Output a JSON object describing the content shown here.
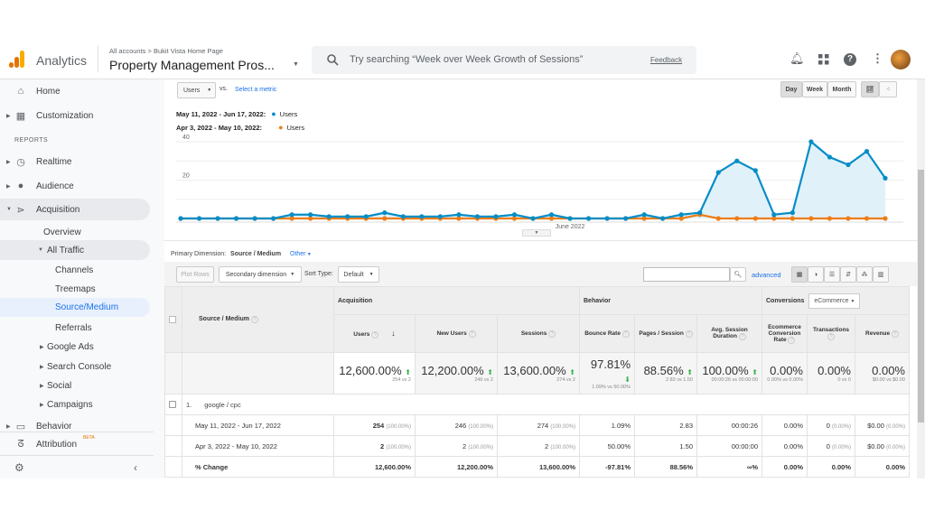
{
  "header": {
    "app_name": "Analytics",
    "breadcrumb": "All accounts > Bukit Vista Home Page",
    "property": "Property Management Pros...",
    "search_placeholder": "Try searching “Week over Week Growth of Sessions”",
    "feedback": "Feedback",
    "icons": [
      "bell-icon",
      "apps-icon",
      "help-icon",
      "more-vert-icon",
      "avatar"
    ]
  },
  "sidebar": {
    "items": [
      {
        "label": "Home",
        "icon": "home-icon"
      },
      {
        "label": "Customization",
        "icon": "dashboard-icon"
      }
    ],
    "reports_label": "REPORTS",
    "reports": [
      {
        "label": "Realtime",
        "icon": "clock-icon"
      },
      {
        "label": "Audience",
        "icon": "person-icon"
      },
      {
        "label": "Acquisition",
        "icon": "acquisition-icon"
      }
    ],
    "acq_sub": [
      "Overview",
      "All Traffic"
    ],
    "all_traffic_sub": [
      "Channels",
      "Treemaps",
      "Source/Medium",
      "Referrals"
    ],
    "acq_more": [
      "Google Ads",
      "Search Console",
      "Social",
      "Campaigns"
    ],
    "behavior": "Behavior",
    "attribution": "Attribution",
    "beta": "BETA"
  },
  "controls": {
    "metric": "Users",
    "vs": "vs.",
    "select_metric": "Select a metric",
    "day": "Day",
    "week": "Week",
    "month": "Month"
  },
  "legend": [
    {
      "range": "May 11, 2022 - Jun 17, 2022:",
      "metric": "Users",
      "color": "#058dc7"
    },
    {
      "range": "Apr 3, 2022 - May 10, 2022:",
      "metric": "Users",
      "color": "#ed7e17"
    }
  ],
  "chart_data": {
    "type": "line",
    "x_label_tick": "June 2022",
    "y_ticks": [
      20,
      40
    ],
    "ylim": [
      0,
      40
    ],
    "grid": true,
    "series": [
      {
        "name": "May 11, 2022 - Jun 17, 2022: Users",
        "color": "#058dc7",
        "values": [
          0,
          0,
          0,
          0,
          0,
          0,
          2,
          2,
          1,
          1,
          1,
          3,
          1,
          1,
          1,
          2,
          1,
          1,
          2,
          0,
          2,
          0,
          0,
          0,
          0,
          2,
          0,
          2,
          3,
          24,
          30,
          25,
          2,
          3,
          40,
          32,
          28,
          35,
          21
        ]
      },
      {
        "name": "Apr 3, 2022 - May 10, 2022: Users",
        "color": "#ed7e17",
        "values": [
          0,
          0,
          0,
          0,
          0,
          0,
          0,
          0,
          0,
          0,
          0,
          0,
          0,
          0,
          0,
          0,
          0,
          0,
          0,
          0,
          0,
          0,
          0,
          0,
          0,
          0,
          0,
          0,
          2,
          0,
          0,
          0,
          0,
          0,
          0,
          0,
          0,
          0,
          0
        ]
      }
    ]
  },
  "dimension": {
    "label": "Primary Dimension:",
    "value": "Source / Medium",
    "other": "Other"
  },
  "toolbar": {
    "plot_rows": "Plot Rows",
    "secondary": "Secondary dimension",
    "sort_type": "Sort Type:",
    "sort_value": "Default",
    "advanced": "advanced"
  },
  "table": {
    "group_acq": "Acquisition",
    "group_beh": "Behavior",
    "group_conv": "Conversions",
    "conv_select": "eCommerce",
    "dim_header": "Source / Medium",
    "columns": [
      "Users",
      "New Users",
      "Sessions",
      "Bounce Rate",
      "Pages / Session",
      "Avg. Session Duration",
      "Ecommerce Conversion Rate",
      "Transactions",
      "Revenue"
    ],
    "totals": [
      {
        "v": "12,600.00%",
        "s": "254 vs 2"
      },
      {
        "v": "12,200.00%",
        "s": "246 vs 2"
      },
      {
        "v": "13,600.00%",
        "s": "274 vs 2"
      },
      {
        "v": "97.81%",
        "s": "1.09% vs 50.00%"
      },
      {
        "v": "88.56%",
        "s": "2.83 vs 1.50"
      },
      {
        "v": "100.00%",
        "s": "00:00:26 vs 00:00:00"
      },
      {
        "v": "0.00%",
        "s": "0.00% vs 0.00%"
      },
      {
        "v": "0.00%",
        "s": "0 vs 0"
      },
      {
        "v": "0.00%",
        "s": "$0.00 vs $0.00"
      }
    ],
    "row_index": "1.",
    "row_label": "google / cpc",
    "rows": [
      {
        "label": "May 11, 2022 - Jun 17, 2022",
        "cells": [
          [
            "254",
            "(100.00%)"
          ],
          [
            "246",
            "(100.00%)"
          ],
          [
            "274",
            "(100.00%)"
          ],
          [
            "1.09%",
            ""
          ],
          [
            "2.83",
            ""
          ],
          [
            "00:00:26",
            ""
          ],
          [
            "0.00%",
            ""
          ],
          [
            "0",
            "(0.00%)"
          ],
          [
            "$0.00",
            "(0.00%)"
          ]
        ]
      },
      {
        "label": "Apr 3, 2022 - May 10, 2022",
        "cells": [
          [
            "2",
            "(100.00%)"
          ],
          [
            "2",
            "(100.00%)"
          ],
          [
            "2",
            "(100.00%)"
          ],
          [
            "50.00%",
            ""
          ],
          [
            "1.50",
            ""
          ],
          [
            "00:00:00",
            ""
          ],
          [
            "0.00%",
            ""
          ],
          [
            "0",
            "(0.00%)"
          ],
          [
            "$0.00",
            "(0.00%)"
          ]
        ]
      },
      {
        "label": "% Change",
        "cells": [
          [
            "12,600.00%",
            ""
          ],
          [
            "12,200.00%",
            ""
          ],
          [
            "13,600.00%",
            ""
          ],
          [
            "-97.81%",
            ""
          ],
          [
            "88.56%",
            ""
          ],
          [
            "∞%",
            ""
          ],
          [
            "0.00%",
            ""
          ],
          [
            "0.00%",
            ""
          ],
          [
            "0.00%",
            ""
          ]
        ]
      }
    ]
  }
}
